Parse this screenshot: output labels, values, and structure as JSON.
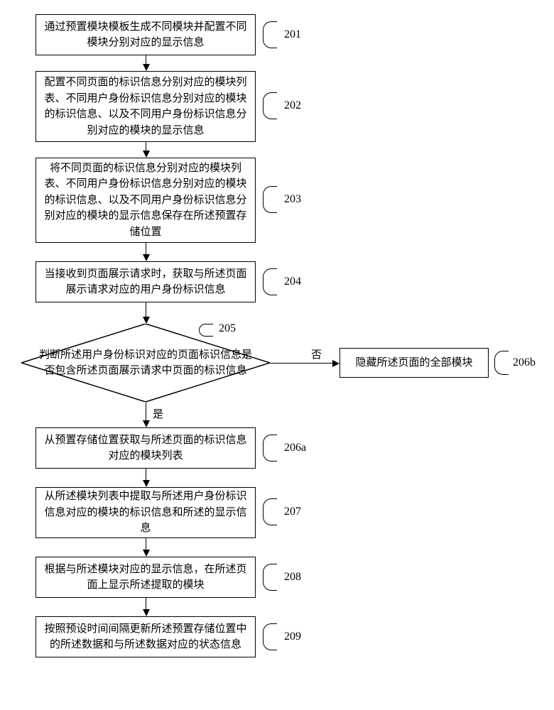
{
  "steps": {
    "s201": {
      "text": "通过预置模块模板生成不同模块并配置不同模块分别对应的显示信息",
      "label": "201"
    },
    "s202": {
      "text": "配置不同页面的标识信息分别对应的模块列表、不同用户身份标识信息分别对应的模块的标识信息、以及不同用户身份标识信息分别对应的模块的显示信息",
      "label": "202"
    },
    "s203": {
      "text": "将不同页面的标识信息分别对应的模块列表、不同用户身份标识信息分别对应的模块的标识信息、以及不同用户身份标识信息分别对应的模块的显示信息保存在所述预置存储位置",
      "label": "203"
    },
    "s204": {
      "text": "当接收到页面展示请求时，获取与所述页面展示请求对应的用户身份标识信息",
      "label": "204"
    },
    "s205": {
      "text": "判断所述用户身份标识对应的页面标识信息是否包含所述页面展示请求中页面的标识信息",
      "label": "205"
    },
    "s206a": {
      "text": "从预置存储位置获取与所述页面的标识信息对应的模块列表",
      "label": "206a"
    },
    "s206b": {
      "text": "隐藏所述页面的全部模块",
      "label": "206b"
    },
    "s207": {
      "text": "从所述模块列表中提取与所述用户身份标识信息对应的模块的标识信息和所述的显示信息",
      "label": "207"
    },
    "s208": {
      "text": "根据与所述模块对应的显示信息，在所述页面上显示所述提取的模块",
      "label": "208"
    },
    "s209": {
      "text": "按照预设时间间隔更新所述预置存储位置中的所述数据和与所述数据对应的状态信息",
      "label": "209"
    }
  },
  "branches": {
    "no": "否",
    "yes": "是"
  }
}
